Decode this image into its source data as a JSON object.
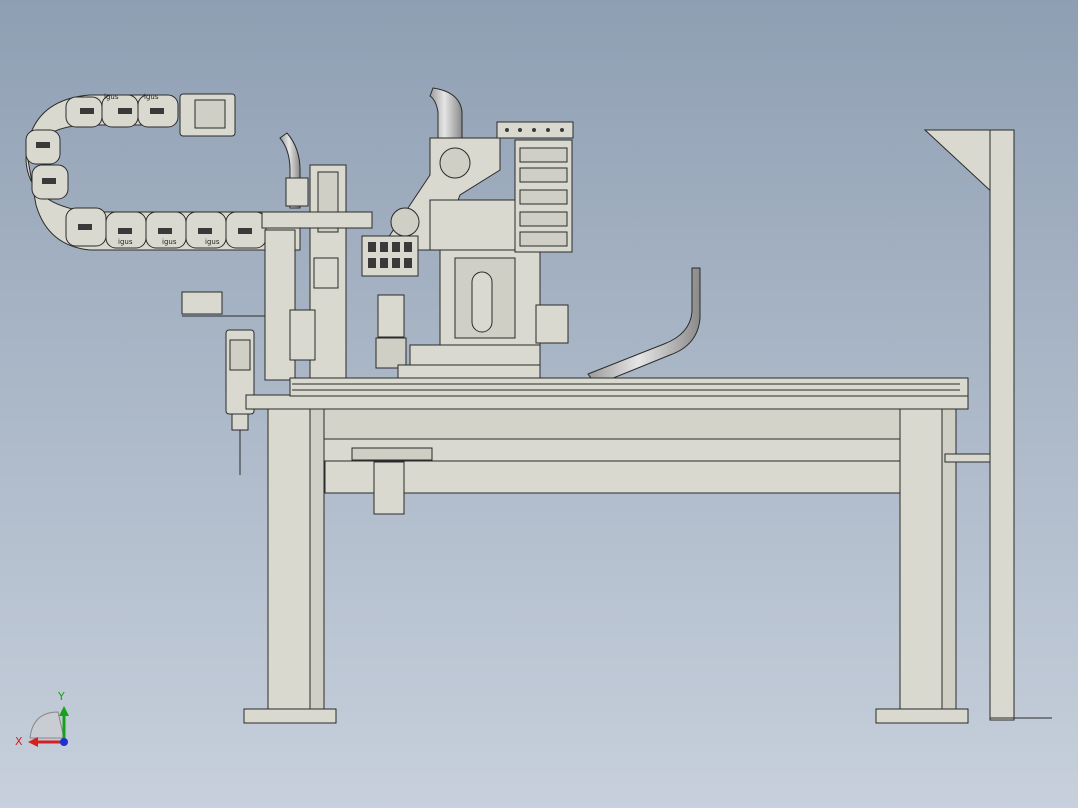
{
  "viewport": {
    "background_top": "#8f9fb3",
    "background_bottom": "#c7d0dc"
  },
  "model": {
    "part_fill": "#d9d9cf",
    "part_stroke": "#2b2b2b",
    "tube_fill": "#c2c2c2",
    "chain_label": "igus"
  },
  "triad": {
    "x_label": "X",
    "y_label": "Y",
    "x_color": "#d42020",
    "y_color": "#1aa01a",
    "z_color": "#2030d0"
  }
}
